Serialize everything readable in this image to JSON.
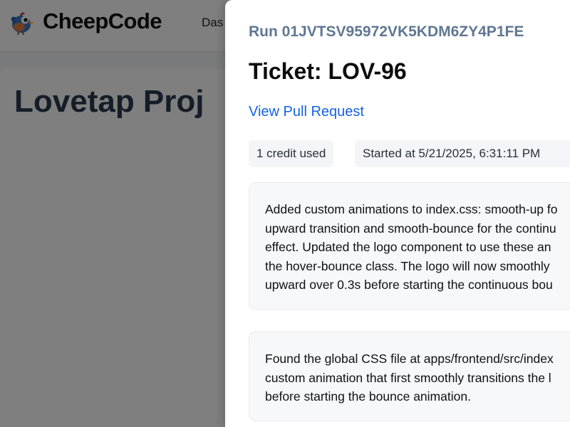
{
  "app": {
    "brand_name": "CheepCode",
    "logo_icon": "bird-logo-icon",
    "nav": {
      "dashboard_label": "Das"
    }
  },
  "main": {
    "project_title": "Lovetap Proj"
  },
  "drawer": {
    "run_id": "Run 01JVTSV95972VK5KDM6ZY4P1FE",
    "ticket_title": "Ticket: LOV-96",
    "pull_request_link": "View Pull Request",
    "credits_badge": "1 credit used",
    "started_badge": "Started at 5/21/2025, 6:31:11 PM",
    "logs": [
      {
        "lines": [
          "Added custom animations to index.css: smooth-up fo",
          "upward transition and smooth-bounce for the continu",
          "effect. Updated the logo component to use these an",
          "the hover-bounce class. The logo will now smoothly",
          "upward over 0.3s before starting the continuous bou"
        ]
      },
      {
        "lines": [
          "Found the global CSS file at apps/frontend/src/index",
          "custom animation that first smoothly transitions the l",
          "before starting the bounce animation."
        ]
      }
    ]
  },
  "colors": {
    "link": "#1463e6",
    "run_id": "#5f7792",
    "overlay": "rgba(0,0,0,0.5)"
  }
}
